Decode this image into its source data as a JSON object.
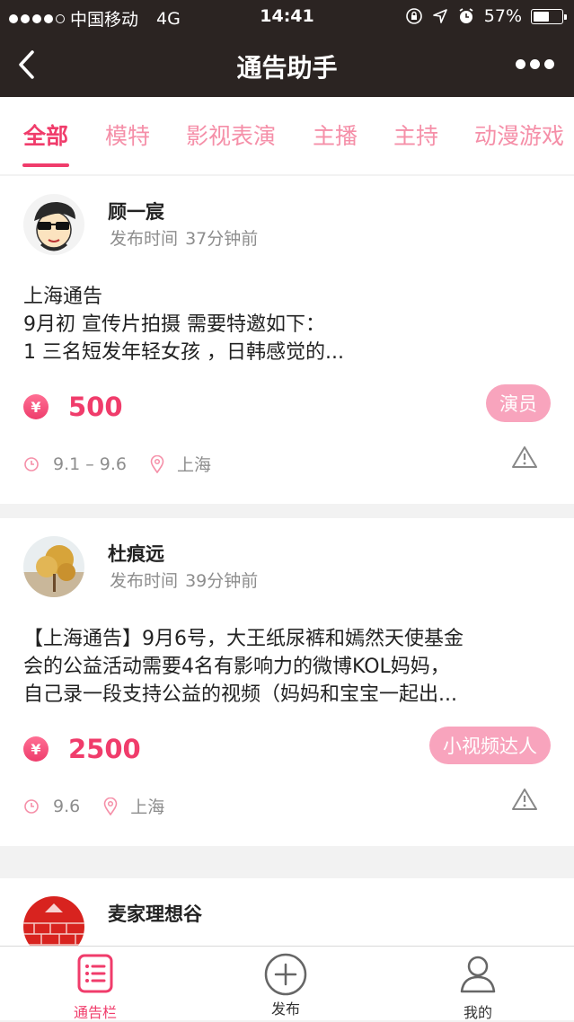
{
  "status": {
    "carrier": "中国移动",
    "network": "4G",
    "time": "14:41",
    "battery": "57%",
    "battery_level": 0.57
  },
  "nav": {
    "title": "通告助手",
    "back_icon": "chevron-left-icon",
    "more_icon": "more-dots-icon"
  },
  "tabs": [
    {
      "label": "全部"
    },
    {
      "label": "模特"
    },
    {
      "label": "影视表演"
    },
    {
      "label": "主播"
    },
    {
      "label": "主持"
    },
    {
      "label": "动漫游戏"
    }
  ],
  "posts": [
    {
      "author": "顾一宸",
      "time_label": "发布时间",
      "time_ago": "37分钟前",
      "lines": [
        "上海通告",
        "9月初 宣传片拍摄 需要特邀如下：",
        "1 三名短发年轻女孩 ，日韩感觉的..."
      ],
      "currency_icon": "¥",
      "price": "500",
      "tag": "演员",
      "date": "9.1 – 9.6",
      "location": "上海"
    },
    {
      "author": "杜痕远",
      "time_label": "发布时间",
      "time_ago": "39分钟前",
      "lines": [
        "【上海通告】9月6号，大王纸尿裤和嫣然天使基金",
        "会的公益活动需要4名有影响力的微博KOL妈妈，",
        "自己录一段支持公益的视频（妈妈和宝宝一起出..."
      ],
      "currency_icon": "¥",
      "price": "2500",
      "tag": "小视频达人",
      "date": "9.6",
      "location": "上海"
    },
    {
      "author": "麦家理想谷"
    }
  ],
  "tabbar": [
    {
      "label": "通告栏",
      "icon": "notice-list-icon"
    },
    {
      "label": "发布",
      "icon": "plus-circle-icon"
    },
    {
      "label": "我的",
      "icon": "user-icon"
    }
  ],
  "colors": {
    "header_bg": "#2b2422",
    "accent": "#f03c6b",
    "tab_inactive": "#f58fa8",
    "tag_bg": "#f8a4bd"
  }
}
